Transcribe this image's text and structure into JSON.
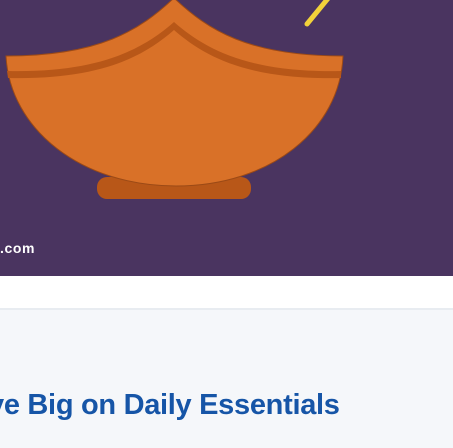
{
  "hero": {
    "watermark_text": ".com",
    "background_color": "#4a3460",
    "bowl_color": "#d97128",
    "bowl_rim_color": "#b85718",
    "chopstick_color": "#f2d23a",
    "image_icon": "bowl-illustration"
  },
  "section": {
    "headline": "ve Big on Daily Essentials",
    "headline_color": "#1655a7",
    "background_color": "#f5f7fa"
  }
}
